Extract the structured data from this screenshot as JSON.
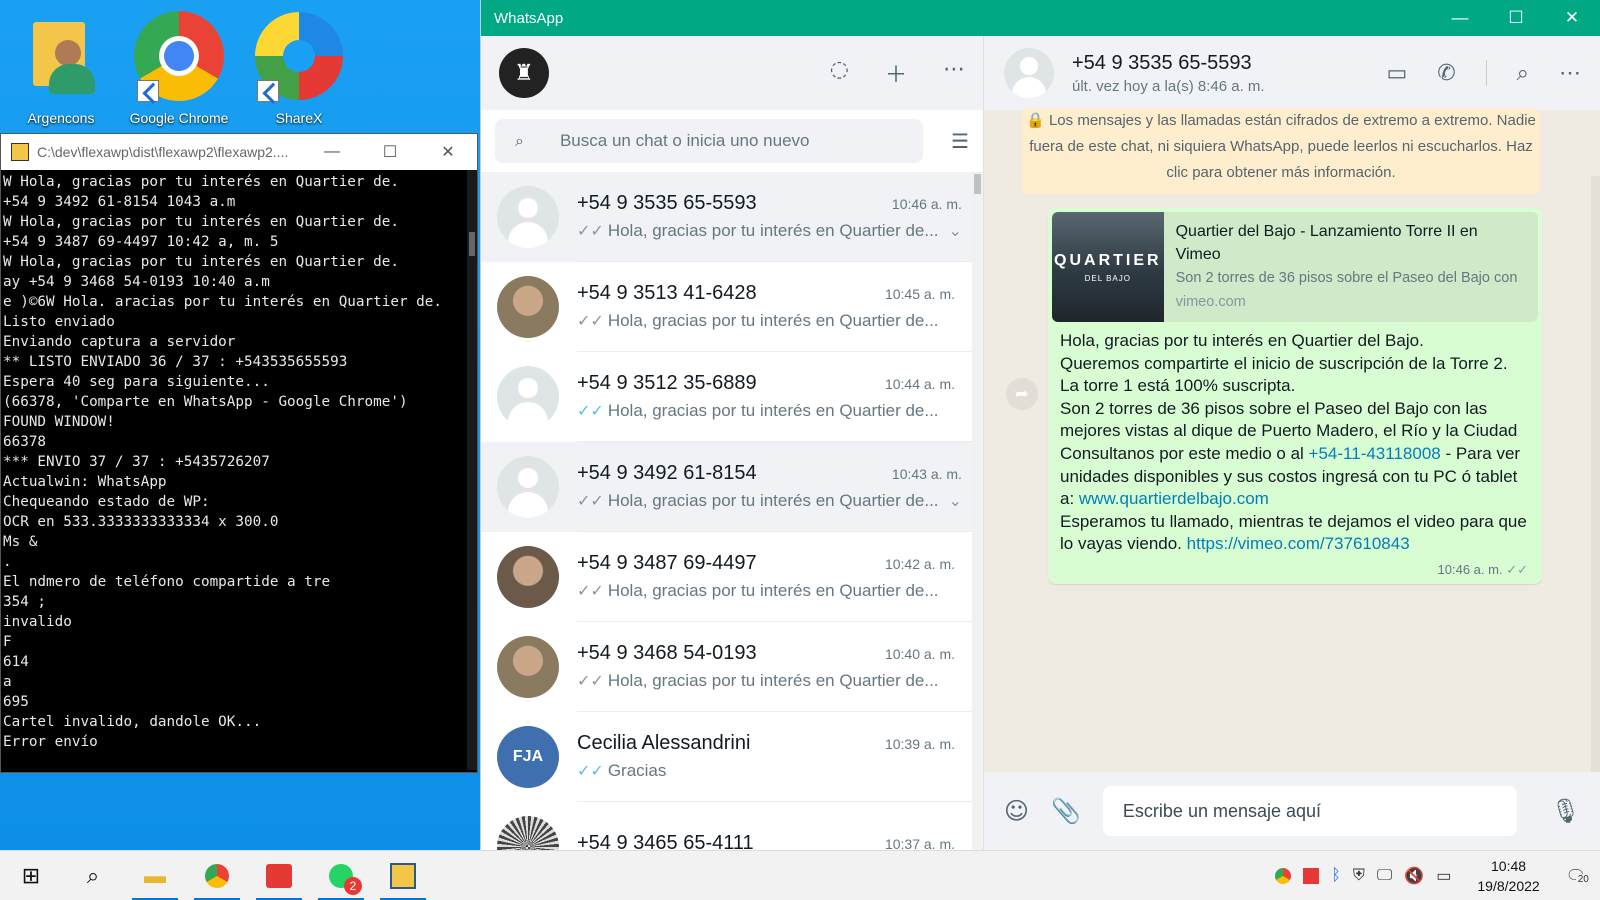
{
  "desktop": {
    "icons": [
      {
        "label": "Argencons"
      },
      {
        "label": "Google Chrome"
      },
      {
        "label": "ShareX"
      }
    ]
  },
  "console": {
    "title": "C:\\dev\\flexawp\\dist\\flexawp2\\flexawp2....",
    "lines": [
      "W Hola, gracias por tu interés en Quartier de.",
      "+54 9 3492 61-8154 1043 a.m",
      "W Hola, gracias por tu interés en Quartier de.",
      "+54 9 3487 69-4497 10:42 a, m. 5",
      "W Hola, gracias por tu interés en Quartier de.",
      "ay +54 9 3468 54-0193 10:40 a.m",
      "e )©6W Hola. aracias por tu interés en Quartier de.",
      "Listo enviado",
      "Enviando captura a servidor",
      "** LISTO ENVIADO 36 / 37 : +543535655593",
      "Espera 40 seg para siguiente...",
      "(66378, 'Comparte en WhatsApp - Google Chrome')",
      "FOUND WINDOW!",
      "66378",
      "*** ENVIO 37 / 37 : +5435726207",
      "Actualwin: WhatsApp",
      "Chequeando estado de WP:",
      "OCR en 533.3333333333334 x 300.0",
      "Ms &",
      ".",
      "El ndmero de teléfono compartide a tre",
      "354 ;",
      "invalido",
      "F",
      "614",
      "a",
      "695",
      "Cartel invalido, dandole OK...",
      "Error envío"
    ]
  },
  "whatsapp": {
    "window_title": "WhatsApp",
    "search_placeholder": "Busca un chat o inicia uno nuevo",
    "chats": [
      {
        "name": "+54 9 3535 65-5593",
        "time": "10:46 a. m.",
        "msg": "Hola, gracias por tu interés en Quartier de...",
        "tick": "✓✓",
        "blue": false,
        "selected": true,
        "chev": true
      },
      {
        "name": "+54 9 3513 41-6428",
        "time": "10:45 a. m.",
        "msg": "Hola, gracias por tu interés en Quartier de...",
        "tick": "✓✓",
        "blue": false
      },
      {
        "name": "+54 9 3512 35-6889",
        "time": "10:44 a. m.",
        "msg": "Hola, gracias por tu interés en Quartier de...",
        "tick": "✓✓",
        "blue": true
      },
      {
        "name": "+54 9 3492 61-8154",
        "time": "10:43 a. m.",
        "msg": "Hola, gracias por tu interés en Quartier de...",
        "tick": "✓✓",
        "blue": false,
        "selected": true,
        "chev": true
      },
      {
        "name": "+54 9 3487 69-4497",
        "time": "10:42 a. m.",
        "msg": "Hola, gracias por tu interés en Quartier de...",
        "tick": "✓✓",
        "blue": false
      },
      {
        "name": "+54 9 3468 54-0193",
        "time": "10:40 a. m.",
        "msg": "Hola, gracias por tu interés en Quartier de...",
        "tick": "✓✓",
        "blue": false
      },
      {
        "name": "Cecilia Alessandrini",
        "time": "10:39 a. m.",
        "msg": "Gracias",
        "tick": "✓✓",
        "blue": true,
        "initials": "FJA"
      },
      {
        "name": "+54 9 3465 65-4111",
        "time": "10:37 a. m.",
        "msg": "",
        "tick": "",
        "blue": false
      }
    ],
    "conversation": {
      "contact": "+54 9 3535 65-5593",
      "status": "últ. vez hoy a la(s) 8:46 a. m.",
      "encryption_notice": "Los mensajes y las llamadas están cifrados de extremo a extremo. Nadie fuera de este chat, ni siquiera WhatsApp, puede leerlos ni escucharlos. Haz clic para obtener más información.",
      "preview_thumb": "QUARTIER",
      "preview_thumb_sub": "DEL BAJO",
      "preview_title": "Quartier del Bajo - Lanzamiento Torre II en Vimeo",
      "preview_desc": "Son 2 torres de 36 pisos sobre el Paseo del Bajo con",
      "preview_url": "vimeo.com",
      "msg_p1": "Hola, gracias por tu interés en Quartier del Bajo.",
      "msg_p2": "Queremos compartirte el inicio de suscripción de la Torre 2.",
      "msg_p3": "La torre 1 está 100% suscripta.",
      "msg_p4": "Son 2 torres de 36 pisos sobre el Paseo del Bajo con las mejores vistas al dique de Puerto Madero, el Río y la Ciudad",
      "msg_p5a": "Consultanos por este medio o al ",
      "msg_phone": "+54-11-43118008",
      "msg_p5b": " - Para ver unidades disponibles y sus costos ingresá con tu PC ó tablet a: ",
      "msg_site": "www.quartierdelbajo.com",
      "msg_p6": "Esperamos tu llamado, mientras te dejamos el video para que lo vayas viendo. ",
      "msg_video": "https://vimeo.com/737610843",
      "msg_time": "10:46 a. m.",
      "input_placeholder": "Escribe un mensaje aquí"
    }
  },
  "taskbar": {
    "time": "10:48",
    "date": "19/8/2022",
    "wa_badge": "2",
    "notif_count": "20"
  }
}
